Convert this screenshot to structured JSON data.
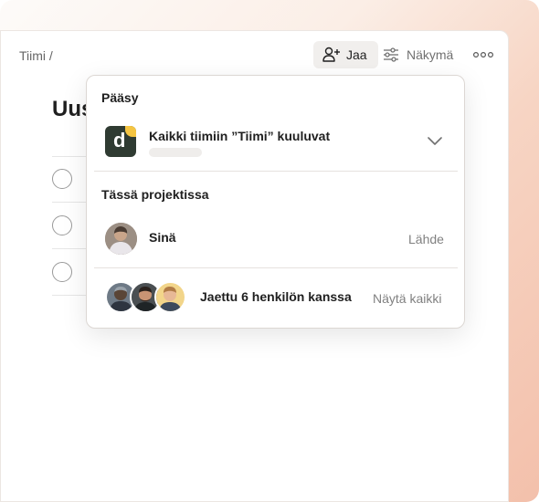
{
  "breadcrumb": {
    "text": "Tiimi /"
  },
  "toolbar": {
    "share_label": "Jaa",
    "view_label": "Näkymä"
  },
  "project": {
    "title": "Uus"
  },
  "popover": {
    "access_title": "Pääsy",
    "team_access_label": "Kaikki tiimiin ”Tiimi” kuuluvat",
    "team_logo_letter": "d",
    "in_project_title": "Tässä projektissa",
    "me_label": "Sinä",
    "leave_label": "Lähde",
    "shared_label": "Jaettu 6 henkilön kanssa",
    "show_all_label": "Näytä kaikki"
  },
  "colors": {
    "accent_bg": "#f1efed",
    "team_logo": "#2f3b32",
    "team_logo_dot": "#f5c542"
  }
}
